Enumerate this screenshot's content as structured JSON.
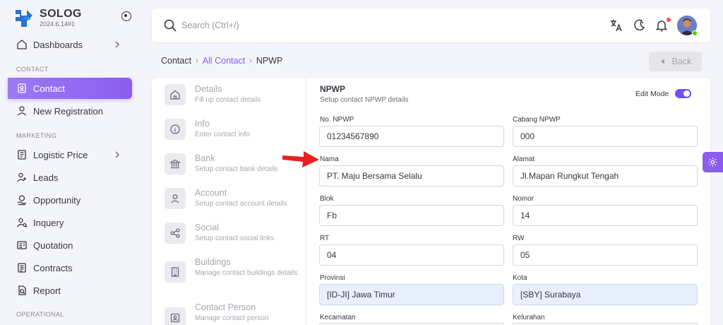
{
  "brand": {
    "name": "SOLOG",
    "version": "2024.6.14#1"
  },
  "sidebar": {
    "sections": [
      "CONTACT",
      "MARKETING",
      "OPERATIONAL"
    ],
    "items": [
      {
        "label": "Dashboards",
        "icon": "home-icon"
      },
      {
        "label": "Contact",
        "icon": "contact-card-icon"
      },
      {
        "label": "New Registration",
        "icon": "user-icon"
      },
      {
        "label": "Logistic Price",
        "icon": "price-list-icon"
      },
      {
        "label": "Leads",
        "icon": "user-plus-icon"
      },
      {
        "label": "Opportunity",
        "icon": "handshake-icon"
      },
      {
        "label": "Inquery",
        "icon": "user-search-icon"
      },
      {
        "label": "Quotation",
        "icon": "quotation-icon"
      },
      {
        "label": "Contracts",
        "icon": "contract-icon"
      },
      {
        "label": "Report",
        "icon": "report-icon"
      }
    ]
  },
  "search": {
    "placeholder": "Search (Ctrl+/)"
  },
  "breadcrumb": {
    "root": "Contact",
    "parent": "All Contact",
    "current": "NPWP"
  },
  "back_label": "Back",
  "steps": [
    {
      "title": "Details",
      "sub": "Fill up contact details",
      "icon": "home-icon"
    },
    {
      "title": "Info",
      "sub": "Enter contact info",
      "icon": "info-icon"
    },
    {
      "title": "Bank",
      "sub": "Setup contact bank details",
      "icon": "bank-icon"
    },
    {
      "title": "Account",
      "sub": "Setup contact account details",
      "icon": "user-icon"
    },
    {
      "title": "Social",
      "sub": "Setup contact social links",
      "icon": "share-icon"
    },
    {
      "title": "Buildings",
      "sub": "Manage contact buildings details",
      "icon": "building-icon"
    },
    {
      "title": "Contact Person",
      "sub": "Manage contact person",
      "icon": "person-card-icon"
    }
  ],
  "form": {
    "title": "NPWP",
    "subtitle": "Setup contact NPWP details",
    "edit_mode_label": "Edit Mode",
    "fields": {
      "no_npwp": {
        "label": "No. NPWP",
        "value": "01234567890"
      },
      "cabang_npwp": {
        "label": "Cabang NPWP",
        "value": "000"
      },
      "nama": {
        "label": "Nama",
        "value": "PT. Maju Bersama Selalu"
      },
      "alamat": {
        "label": "Alamat",
        "value": "Jl.Mapan Rungkut Tengah"
      },
      "blok": {
        "label": "Blok",
        "value": "Fb"
      },
      "nomor": {
        "label": "Nomor",
        "value": "14"
      },
      "rt": {
        "label": "RT",
        "value": "04"
      },
      "rw": {
        "label": "RW",
        "value": "05"
      },
      "provinsi": {
        "label": "Provinsi",
        "value": "[ID-JI] Jawa Timur"
      },
      "kota": {
        "label": "Kota",
        "value": "[SBY] Surabaya"
      },
      "kecamatan": {
        "label": "Kecamatan",
        "value": ""
      },
      "kelurahan": {
        "label": "Kelurahan",
        "value": ""
      }
    }
  },
  "colors": {
    "accent": "#8c5cf0",
    "annotation_arrow": "#e8201f",
    "notification_dot": "#ff4c51",
    "status_online": "#56ca00"
  }
}
